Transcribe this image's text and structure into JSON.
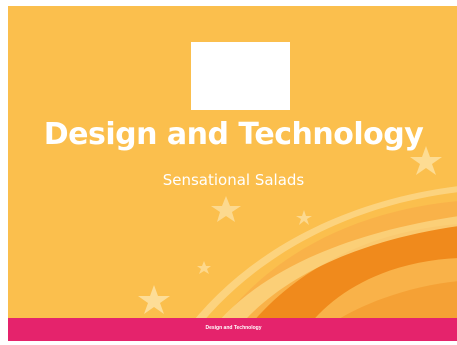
{
  "slide": {
    "title": "Design and Technology",
    "subtitle": "Sensational Salads",
    "footer_label": "Design and Technology",
    "footer_rest": "",
    "image_placeholder": "",
    "colors": {
      "background": "#fbbf4d",
      "footer": "#e5236c",
      "swoosh_dark": "#f08a1c",
      "swoosh_light": "#f7a23a",
      "text": "#ffffff"
    },
    "decorations": [
      "star-icon",
      "star-icon",
      "star-icon",
      "star-icon",
      "star-icon",
      "swoosh"
    ]
  }
}
